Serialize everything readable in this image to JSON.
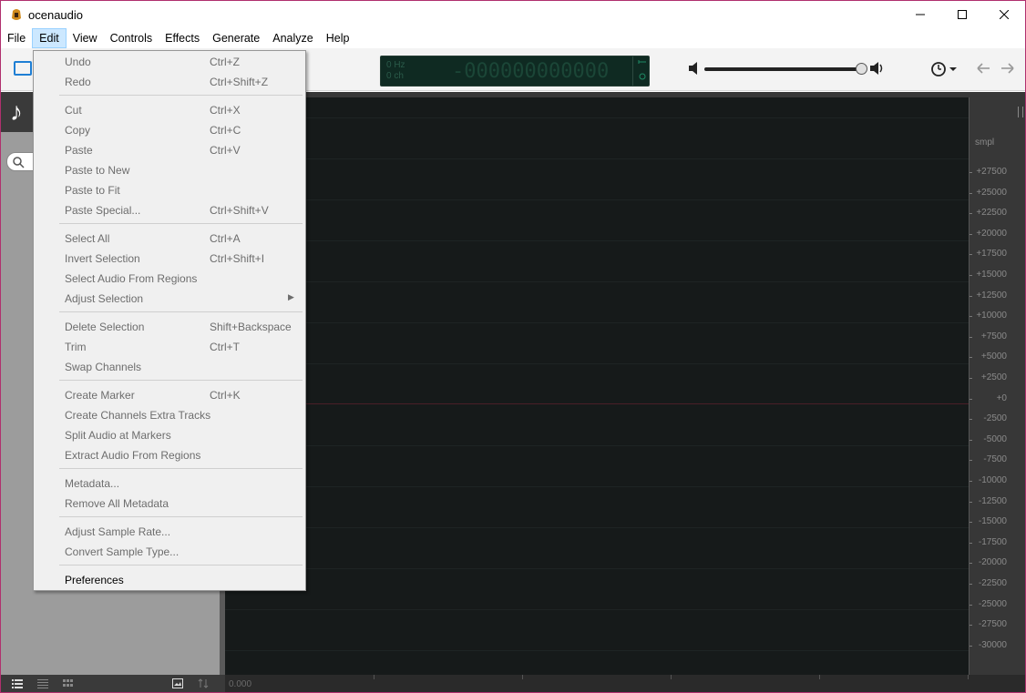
{
  "window": {
    "title": "ocenaudio"
  },
  "menubar": {
    "items": [
      "File",
      "Edit",
      "View",
      "Controls",
      "Effects",
      "Generate",
      "Analyze",
      "Help"
    ],
    "active": "Edit"
  },
  "lcd": {
    "hz": "0 Hz",
    "ch": "0 ch",
    "digits": "-000000000000"
  },
  "edit_menu": {
    "undo": {
      "label": "Undo",
      "shortcut": "Ctrl+Z"
    },
    "redo": {
      "label": "Redo",
      "shortcut": "Ctrl+Shift+Z"
    },
    "cut": {
      "label": "Cut",
      "shortcut": "Ctrl+X"
    },
    "copy": {
      "label": "Copy",
      "shortcut": "Ctrl+C"
    },
    "paste": {
      "label": "Paste",
      "shortcut": "Ctrl+V"
    },
    "paste_new": {
      "label": "Paste to New"
    },
    "paste_fit": {
      "label": "Paste to Fit"
    },
    "paste_special": {
      "label": "Paste Special...",
      "shortcut": "Ctrl+Shift+V"
    },
    "select_all": {
      "label": "Select All",
      "shortcut": "Ctrl+A"
    },
    "invert_selection": {
      "label": "Invert Selection",
      "shortcut": "Ctrl+Shift+I"
    },
    "select_regions": {
      "label": "Select Audio From Regions"
    },
    "adjust_selection": {
      "label": "Adjust Selection"
    },
    "delete_selection": {
      "label": "Delete Selection",
      "shortcut": "Shift+Backspace"
    },
    "trim": {
      "label": "Trim",
      "shortcut": "Ctrl+T"
    },
    "swap_channels": {
      "label": "Swap Channels"
    },
    "create_marker": {
      "label": "Create Marker",
      "shortcut": "Ctrl+K"
    },
    "create_extra_tracks": {
      "label": "Create Channels Extra Tracks"
    },
    "split_markers": {
      "label": "Split Audio at Markers"
    },
    "extract_regions": {
      "label": "Extract Audio From Regions"
    },
    "metadata": {
      "label": "Metadata..."
    },
    "remove_metadata": {
      "label": "Remove All Metadata"
    },
    "adjust_rate": {
      "label": "Adjust Sample Rate..."
    },
    "convert_type": {
      "label": "Convert Sample Type..."
    },
    "preferences": {
      "label": "Preferences"
    }
  },
  "scale": {
    "unit": "smpl",
    "labels": [
      "+27500",
      "+25000",
      "+22500",
      "+20000",
      "+17500",
      "+15000",
      "+12500",
      "+10000",
      "+7500",
      "+5000",
      "+2500",
      "+0",
      "-2500",
      "-5000",
      "-7500",
      "-10000",
      "-12500",
      "-15000",
      "-17500",
      "-20000",
      "-22500",
      "-25000",
      "-27500",
      "-30000"
    ]
  },
  "timeline": {
    "start": "0.000"
  },
  "colors": {
    "accent": "#1f7fd4",
    "lcd_bg": "#0f2a22",
    "wave_bg": "#161a1a",
    "zero_line": "#4a1f28"
  }
}
